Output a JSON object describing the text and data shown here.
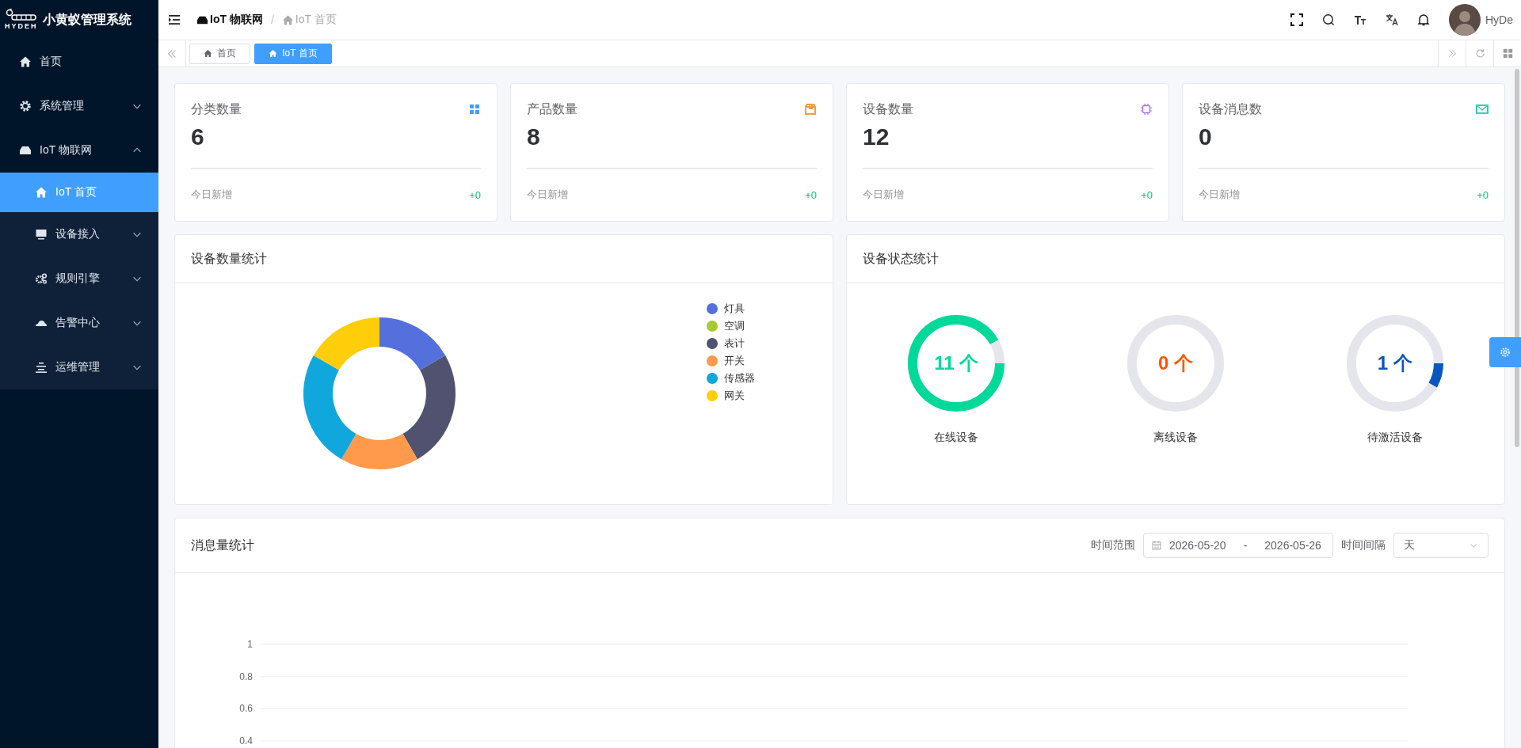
{
  "sidebar": {
    "logo_text": "HYDEH",
    "title": "小黄蚁管理系统",
    "items": [
      {
        "label": "首页",
        "selected": false
      },
      {
        "label": "系统管理",
        "selected": false,
        "expanded": false
      },
      {
        "label": "IoT 物联网",
        "selected": false,
        "expanded": true,
        "children": [
          {
            "label": "IoT 首页",
            "selected": true
          },
          {
            "label": "设备接入",
            "selected": false,
            "expanded": false
          },
          {
            "label": "规则引擎",
            "selected": false,
            "expanded": false
          },
          {
            "label": "告警中心",
            "selected": false,
            "expanded": false
          },
          {
            "label": "运维管理",
            "selected": false,
            "expanded": false
          }
        ]
      }
    ]
  },
  "header": {
    "breadcrumb": [
      {
        "label": "IoT 物联网"
      },
      {
        "label": "IoT 首页"
      }
    ],
    "separator": "/",
    "user": {
      "name": "HyDe"
    }
  },
  "tabs": [
    {
      "label": "首页",
      "selected": false
    },
    {
      "label": "IoT 首页",
      "selected": true
    }
  ],
  "stat_cards": [
    {
      "title": "分类数量",
      "value": "6",
      "footer_label": "今日新增",
      "footer_value": "+0",
      "color": "#409eff"
    },
    {
      "title": "产品数量",
      "value": "8",
      "footer_label": "今日新增",
      "footer_value": "+0",
      "color": "#ff9a3c"
    },
    {
      "title": "设备数量",
      "value": "12",
      "footer_label": "今日新增",
      "footer_value": "+0",
      "color": "#a970ff"
    },
    {
      "title": "设备消息数",
      "value": "0",
      "footer_label": "今日新增",
      "footer_value": "+0",
      "color": "#2ed3b7"
    }
  ],
  "device_count_panel": {
    "title": "设备数量统计",
    "legend": [
      {
        "name": "灯具",
        "color": "#5470dd"
      },
      {
        "name": "空调",
        "color": "#a5cc2f"
      },
      {
        "name": "表计",
        "color": "#50526f"
      },
      {
        "name": "开关",
        "color": "#ff9a4c"
      },
      {
        "name": "传感器",
        "color": "#10a7dc"
      },
      {
        "name": "网关",
        "color": "#fece0a"
      }
    ]
  },
  "device_status_panel": {
    "title": "设备状态统计",
    "items": [
      {
        "value": "11 个",
        "label": "在线设备",
        "level": 0.917,
        "color": "#00d99a"
      },
      {
        "value": "0 个",
        "label": "离线设备",
        "level": 0,
        "color": "#ff5500"
      },
      {
        "value": "1 个",
        "label": "待激活设备",
        "level": 0.083,
        "color": "#0b55be"
      }
    ]
  },
  "message_panel": {
    "title": "消息量统计",
    "range_label": "时间范围",
    "start_date": "2026-05-20",
    "range_separator": "-",
    "end_date": "2026-05-26",
    "interval_label": "时间间隔",
    "interval_value": "天",
    "chart_axis_labels": [
      "1",
      "0.8",
      "0.6",
      "0.4"
    ]
  }
}
